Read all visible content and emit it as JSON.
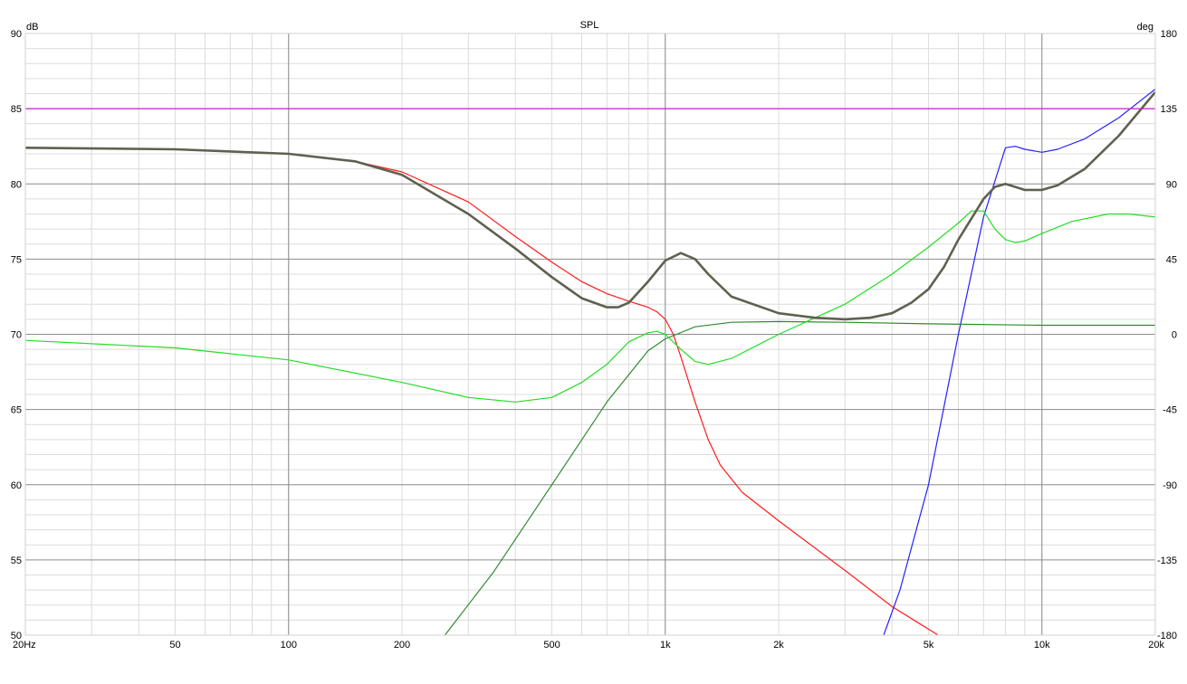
{
  "chart_data": {
    "type": "line",
    "title": "SPL",
    "x_axis": {
      "scale": "log",
      "range": [
        20,
        20000
      ],
      "tick_values": [
        20,
        50,
        100,
        200,
        500,
        1000,
        2000,
        5000,
        10000,
        20000
      ],
      "tick_labels": [
        "20Hz",
        "50",
        "100",
        "200",
        "500",
        "1k",
        "2k",
        "5k",
        "10k",
        "20k"
      ]
    },
    "y_left": {
      "unit": "dB",
      "range": [
        50,
        90
      ],
      "tick_labels": [
        "90",
        "85",
        "80",
        "75",
        "70",
        "65",
        "60",
        "55",
        "50"
      ]
    },
    "y_right": {
      "unit": "deg",
      "range": [
        -180,
        180
      ],
      "tick_labels": [
        "180",
        "135",
        "90",
        "45",
        "0",
        "-45",
        "-90",
        "-135",
        "-180"
      ]
    },
    "grid": true,
    "series": [
      {
        "axis": "left",
        "color": "#ff1a1a",
        "points": [
          [
            20,
            82.4
          ],
          [
            50,
            82.3
          ],
          [
            100,
            82.0
          ],
          [
            150,
            81.5
          ],
          [
            200,
            80.8
          ],
          [
            300,
            78.8
          ],
          [
            400,
            76.5
          ],
          [
            500,
            74.8
          ],
          [
            600,
            73.5
          ],
          [
            700,
            72.7
          ],
          [
            800,
            72.2
          ],
          [
            900,
            71.8
          ],
          [
            950,
            71.5
          ],
          [
            1000,
            71.0
          ],
          [
            1050,
            70.0
          ],
          [
            1100,
            68.5
          ],
          [
            1200,
            65.5
          ],
          [
            1300,
            63.0
          ],
          [
            1400,
            61.3
          ],
          [
            1600,
            59.5
          ],
          [
            2000,
            57.6
          ],
          [
            3000,
            54.3
          ],
          [
            4000,
            51.9
          ],
          [
            5000,
            50.4
          ],
          [
            5300,
            50.0
          ]
        ]
      },
      {
        "axis": "left",
        "color": "#2222ff",
        "points": [
          [
            3800,
            50.0
          ],
          [
            4200,
            53.0
          ],
          [
            5000,
            60.0
          ],
          [
            6000,
            70.0
          ],
          [
            7000,
            77.8
          ],
          [
            8000,
            82.4
          ],
          [
            8500,
            82.5
          ],
          [
            9000,
            82.3
          ],
          [
            10000,
            82.1
          ],
          [
            11000,
            82.3
          ],
          [
            13000,
            83.0
          ],
          [
            16000,
            84.4
          ],
          [
            20000,
            86.3
          ]
        ]
      },
      {
        "axis": "left",
        "color": "#2f8a2f",
        "points": [
          [
            260,
            50.0
          ],
          [
            350,
            54.2
          ],
          [
            500,
            60.0
          ],
          [
            700,
            65.5
          ],
          [
            900,
            68.9
          ],
          [
            1000,
            69.7
          ],
          [
            1200,
            70.5
          ],
          [
            1500,
            70.8
          ],
          [
            2000,
            70.85
          ],
          [
            3000,
            70.8
          ],
          [
            5000,
            70.7
          ],
          [
            10000,
            70.6
          ],
          [
            20000,
            70.6
          ]
        ]
      },
      {
        "axis": "left",
        "color": "#22dd22",
        "points": [
          [
            20,
            69.6
          ],
          [
            50,
            69.1
          ],
          [
            100,
            68.3
          ],
          [
            200,
            66.8
          ],
          [
            300,
            65.8
          ],
          [
            400,
            65.5
          ],
          [
            500,
            65.8
          ],
          [
            600,
            66.8
          ],
          [
            700,
            68.0
          ],
          [
            800,
            69.5
          ],
          [
            900,
            70.1
          ],
          [
            950,
            70.2
          ],
          [
            1000,
            70.0
          ],
          [
            1100,
            69.0
          ],
          [
            1200,
            68.2
          ],
          [
            1300,
            68.0
          ],
          [
            1500,
            68.4
          ],
          [
            2000,
            70.0
          ],
          [
            3000,
            72.0
          ],
          [
            4000,
            74.0
          ],
          [
            5000,
            75.8
          ],
          [
            6000,
            77.4
          ],
          [
            6500,
            78.2
          ],
          [
            7000,
            78.2
          ],
          [
            7500,
            77.0
          ],
          [
            8000,
            76.3
          ],
          [
            8500,
            76.1
          ],
          [
            9000,
            76.2
          ],
          [
            10000,
            76.7
          ],
          [
            12000,
            77.5
          ],
          [
            15000,
            78.0
          ],
          [
            17000,
            78.0
          ],
          [
            20000,
            77.8
          ]
        ]
      },
      {
        "axis": "left",
        "color": "#606050",
        "points": [
          [
            20,
            82.4
          ],
          [
            50,
            82.3
          ],
          [
            100,
            82.0
          ],
          [
            150,
            81.5
          ],
          [
            200,
            80.6
          ],
          [
            300,
            78.0
          ],
          [
            400,
            75.7
          ],
          [
            500,
            73.8
          ],
          [
            600,
            72.4
          ],
          [
            700,
            71.8
          ],
          [
            750,
            71.8
          ],
          [
            800,
            72.1
          ],
          [
            900,
            73.5
          ],
          [
            1000,
            74.9
          ],
          [
            1100,
            75.4
          ],
          [
            1200,
            75.0
          ],
          [
            1300,
            74.0
          ],
          [
            1500,
            72.5
          ],
          [
            2000,
            71.4
          ],
          [
            2500,
            71.1
          ],
          [
            3000,
            71.0
          ],
          [
            3500,
            71.1
          ],
          [
            4000,
            71.4
          ],
          [
            4500,
            72.1
          ],
          [
            5000,
            73.0
          ],
          [
            5500,
            74.5
          ],
          [
            6000,
            76.3
          ],
          [
            7000,
            79.0
          ],
          [
            7500,
            79.8
          ],
          [
            8000,
            80.0
          ],
          [
            8500,
            79.8
          ],
          [
            9000,
            79.6
          ],
          [
            10000,
            79.6
          ],
          [
            11000,
            79.9
          ],
          [
            13000,
            81.0
          ],
          [
            16000,
            83.2
          ],
          [
            20000,
            86.1
          ]
        ]
      },
      {
        "axis": "left",
        "color": "#cc22cc",
        "points": [
          [
            20,
            85.0
          ],
          [
            20000,
            85.0
          ]
        ]
      }
    ]
  }
}
